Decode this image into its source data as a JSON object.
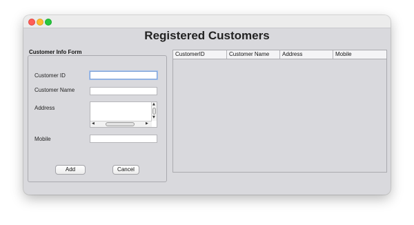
{
  "window": {
    "title": "Registered Customers"
  },
  "form": {
    "legend": "Customer Info Form",
    "fields": {
      "customer_id": {
        "label": "Customer ID",
        "value": ""
      },
      "customer_name": {
        "label": "Customer Name",
        "value": ""
      },
      "address": {
        "label": "Address",
        "value": ""
      },
      "mobile": {
        "label": "Mobile",
        "value": ""
      }
    },
    "buttons": {
      "add": "Add",
      "cancel": "Cancel"
    }
  },
  "table": {
    "columns": [
      "CustomerID",
      "Customer Name",
      "Address",
      "Mobile"
    ],
    "rows": []
  },
  "icons": {
    "close": "window-close-icon",
    "minimize": "window-minimize-icon",
    "zoom": "window-zoom-icon"
  },
  "colors": {
    "close": "#ff5f57",
    "minimize": "#febc2e",
    "zoom": "#28c840",
    "window_bg": "#d9d9dd"
  }
}
